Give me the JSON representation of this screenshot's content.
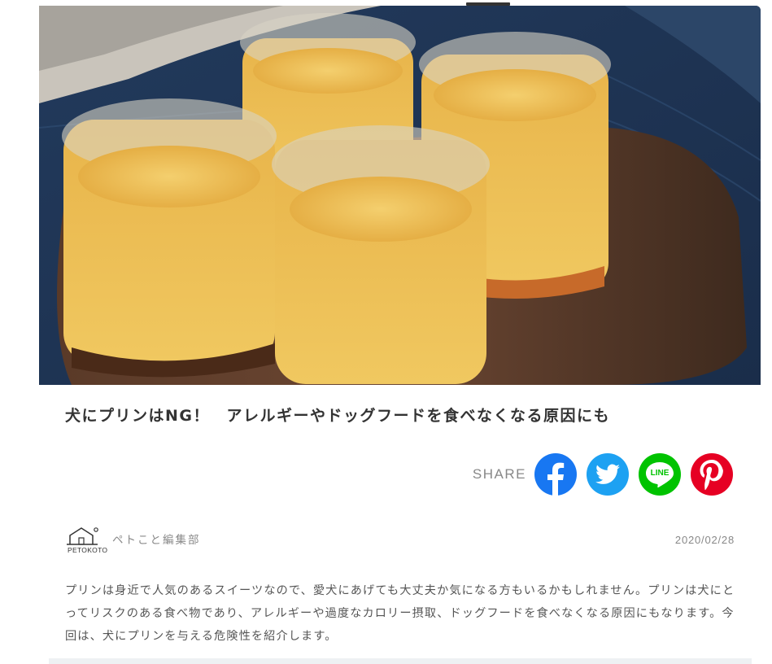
{
  "article": {
    "title": "犬にプリンはNG！　アレルギーやドッグフードを食べなくなる原因にも",
    "hero_image": {
      "subject": "pudding-jars-photo"
    }
  },
  "share": {
    "label": "SHARE",
    "buttons": [
      {
        "name": "facebook",
        "icon": "facebook-icon",
        "color": "#1877f2"
      },
      {
        "name": "twitter",
        "icon": "twitter-icon",
        "color": "#1da1f2"
      },
      {
        "name": "line",
        "icon": "line-icon",
        "color": "#00c300",
        "text": "LINE"
      },
      {
        "name": "pinterest",
        "icon": "pinterest-icon",
        "color": "#e60023"
      }
    ]
  },
  "author": {
    "logo_text": "PETOKOTO",
    "name": "ペトこと編集部"
  },
  "date": "2020/02/28",
  "intro": "プリンは身近で人気のあるスイーツなので、愛犬にあげても大丈夫か気になる方もいるかもしれません。プリンは犬にとってリスクのある食べ物であり、アレルギーや過度なカロリー摂取、ドッグフードを食べなくなる原因にもなります。今回は、犬にプリンを与える危険性を紹介します。"
}
